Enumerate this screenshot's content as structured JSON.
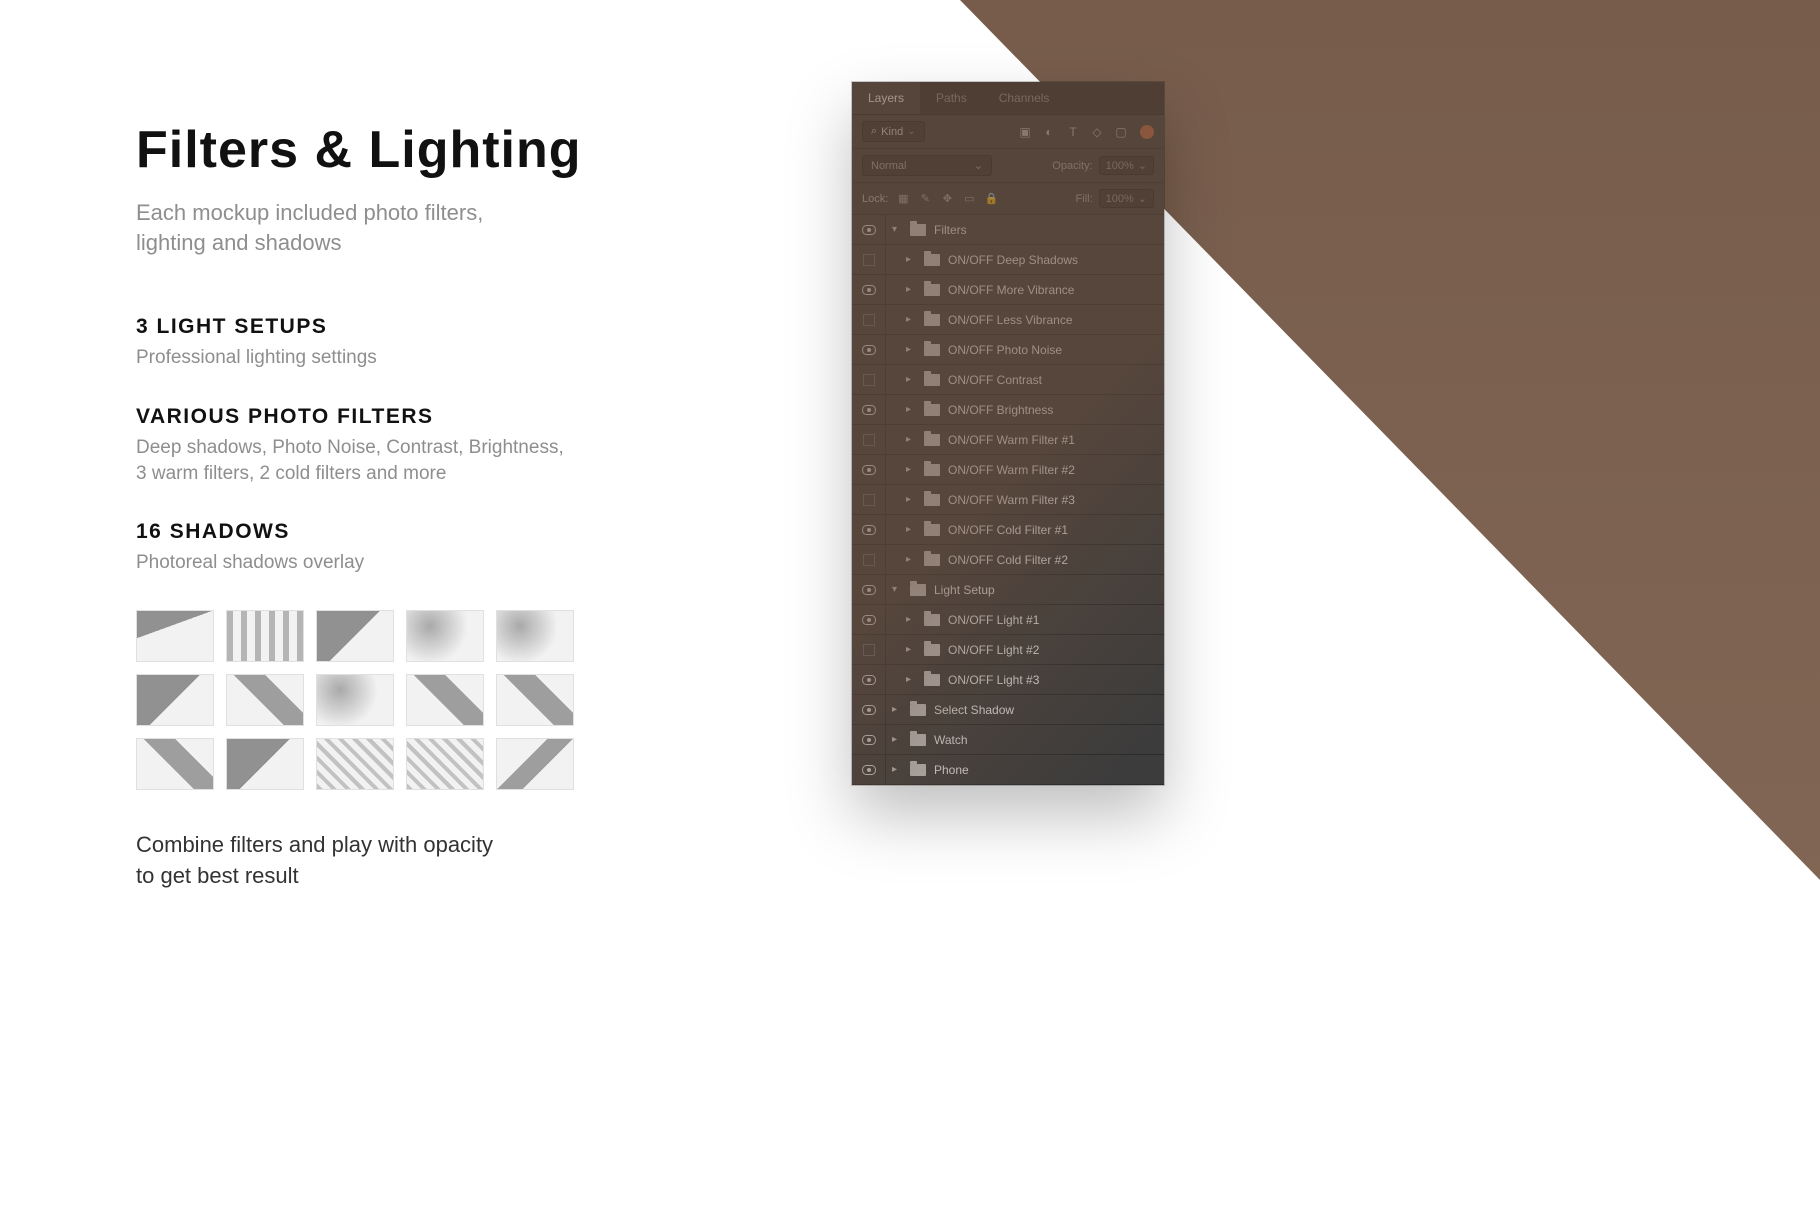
{
  "content": {
    "title": "Filters & Lighting",
    "subtitle_line1": "Each mockup included photo filters,",
    "subtitle_line2": "lighting and shadows",
    "section1_title": "3 LIGHT SETUPS",
    "section1_desc": "Professional lighting settings",
    "section2_title": "VARIOUS PHOTO FILTERS",
    "section2_desc_line1": "Deep shadows, Photo Noise, Contrast, Brightness,",
    "section2_desc_line2": "3 warm filters, 2 cold filters and more",
    "section3_title": "16 SHADOWS",
    "section3_desc": "Photoreal shadows overlay",
    "footer_line1": "Combine filters and play with opacity",
    "footer_line2": "to get best result"
  },
  "panel": {
    "tabs": {
      "layers": "Layers",
      "paths": "Paths",
      "channels": "Channels"
    },
    "kind_label": "Kind",
    "blend_mode": "Normal",
    "opacity_label": "Opacity:",
    "opacity_value": "100%",
    "lock_label": "Lock:",
    "fill_label": "Fill:",
    "fill_value": "100%",
    "layers": [
      {
        "name": "Filters",
        "level": 0,
        "open": true,
        "visible": true
      },
      {
        "name": "ON/OFF Deep Shadows",
        "level": 1,
        "visible": false
      },
      {
        "name": "ON/OFF More Vibrance",
        "level": 1,
        "visible": true
      },
      {
        "name": "ON/OFF Less Vibrance",
        "level": 1,
        "visible": false
      },
      {
        "name": "ON/OFF Photo Noise",
        "level": 1,
        "visible": true
      },
      {
        "name": "ON/OFF Contrast",
        "level": 1,
        "visible": false
      },
      {
        "name": "ON/OFF Brightness",
        "level": 1,
        "visible": true
      },
      {
        "name": "ON/OFF Warm Filter #1",
        "level": 1,
        "visible": false
      },
      {
        "name": "ON/OFF Warm Filter #2",
        "level": 1,
        "visible": true
      },
      {
        "name": "ON/OFF Warm Filter #3",
        "level": 1,
        "visible": false
      },
      {
        "name": "ON/OFF Cold Filter #1",
        "level": 1,
        "visible": true
      },
      {
        "name": "ON/OFF Cold Filter #2",
        "level": 1,
        "visible": false
      },
      {
        "name": "Light Setup",
        "level": 0,
        "open": true,
        "visible": true
      },
      {
        "name": "ON/OFF Light #1",
        "level": 1,
        "visible": true
      },
      {
        "name": "ON/OFF Light #2",
        "level": 1,
        "visible": false
      },
      {
        "name": "ON/OFF Light #3",
        "level": 1,
        "visible": true
      },
      {
        "name": "Select Shadow",
        "level": 0,
        "open": false,
        "visible": true
      },
      {
        "name": "Watch",
        "level": 0,
        "open": false,
        "visible": true
      },
      {
        "name": "Phone",
        "level": 0,
        "open": false,
        "visible": true
      }
    ]
  }
}
